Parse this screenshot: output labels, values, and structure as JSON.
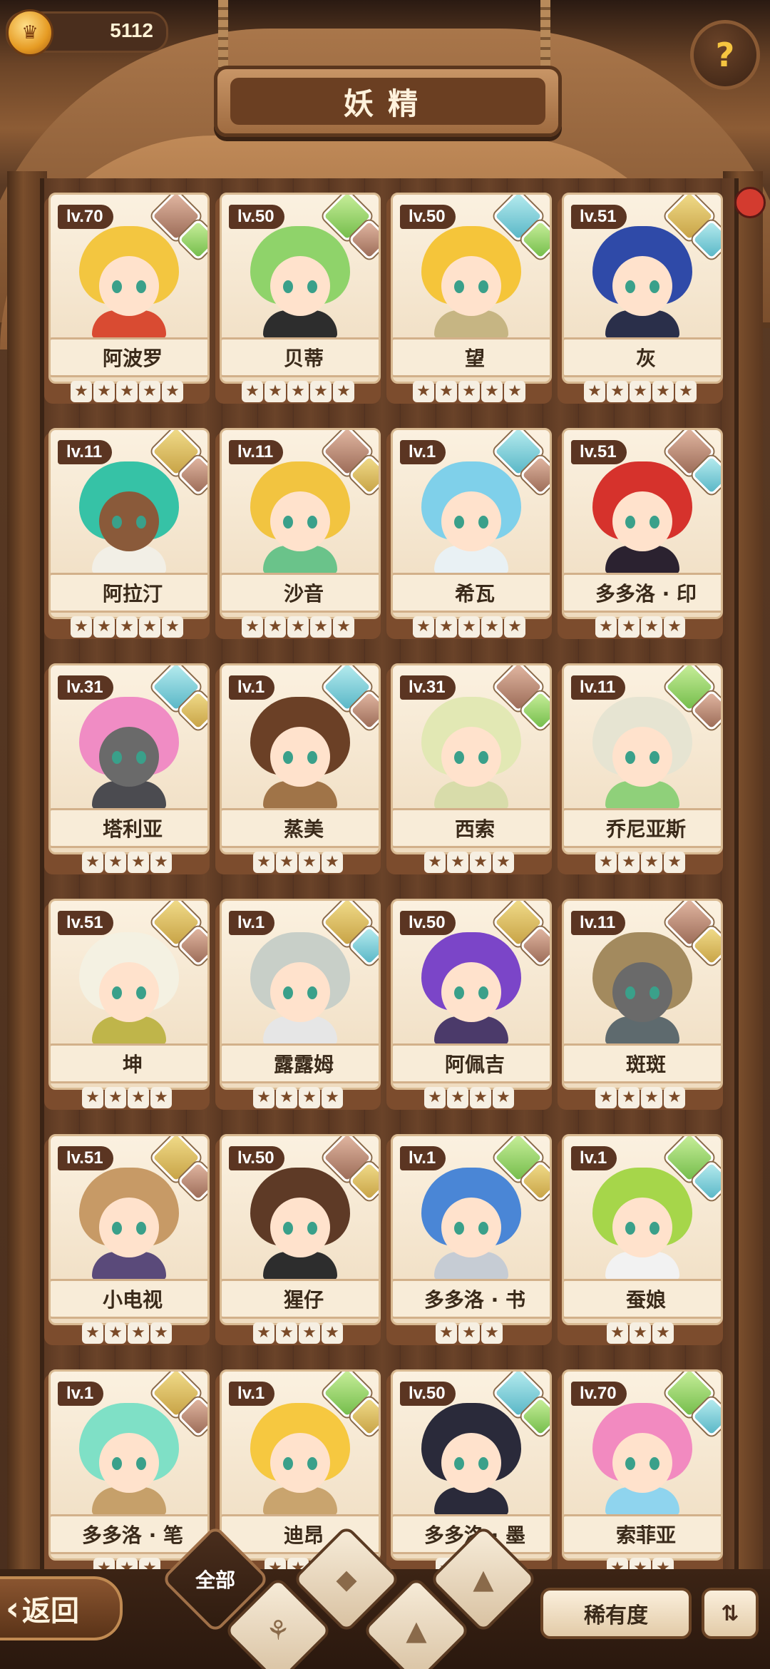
{
  "header": {
    "coins": "5112",
    "title": "妖精",
    "help_icon": "question-icon"
  },
  "bottom": {
    "back_label": "返回",
    "filter_all_label": "全部",
    "rarity_label": "稀有度",
    "sort_icon": "sort-icon"
  },
  "cards": [
    {
      "level": "lv.70",
      "name": "阿波罗",
      "stars": 5,
      "elements": [
        "rock",
        "plant"
      ],
      "hair": "#f3c640",
      "skin": "light",
      "shirt": "#d94b32"
    },
    {
      "level": "lv.50",
      "name": "贝蒂",
      "stars": 5,
      "elements": [
        "plant",
        "rock"
      ],
      "hair": "#8fd36a",
      "skin": "light",
      "shirt": "#2d2d2d"
    },
    {
      "level": "lv.50",
      "name": "望",
      "stars": 5,
      "elements": [
        "water",
        "plant"
      ],
      "hair": "#f5c53a",
      "skin": "light",
      "shirt": "#c6b583"
    },
    {
      "level": "lv.51",
      "name": "灰",
      "stars": 5,
      "elements": [
        "earth",
        "water"
      ],
      "hair": "#2f4aa8",
      "skin": "light",
      "shirt": "#2a2f4a"
    },
    {
      "level": "lv.11",
      "name": "阿拉汀",
      "stars": 5,
      "elements": [
        "earth",
        "rock"
      ],
      "hair": "#36c2a6",
      "skin": "dark",
      "shirt": "#f2efe6"
    },
    {
      "level": "lv.11",
      "name": "沙音",
      "stars": 5,
      "elements": [
        "rock",
        "earth"
      ],
      "hair": "#f2c440",
      "skin": "light",
      "shirt": "#6ac38a"
    },
    {
      "level": "lv.1",
      "name": "希瓦",
      "stars": 5,
      "elements": [
        "water",
        "rock"
      ],
      "hair": "#7fd0ea",
      "skin": "light",
      "shirt": "#e9f1f4"
    },
    {
      "level": "lv.51",
      "name": "多多洛 · 印",
      "stars": 4,
      "elements": [
        "rock",
        "water"
      ],
      "hair": "#d6322c",
      "skin": "light",
      "shirt": "#2b2230"
    },
    {
      "level": "lv.31",
      "name": "塔利亚",
      "stars": 4,
      "elements": [
        "water",
        "earth"
      ],
      "hair": "#f08cc4",
      "skin": "grey",
      "shirt": "#4b4b50"
    },
    {
      "level": "lv.1",
      "name": "蒸美",
      "stars": 4,
      "elements": [
        "water",
        "rock"
      ],
      "hair": "#6b4026",
      "skin": "light",
      "shirt": "#a07448"
    },
    {
      "level": "lv.31",
      "name": "西索",
      "stars": 4,
      "elements": [
        "rock",
        "plant"
      ],
      "hair": "#e2e8b4",
      "skin": "light",
      "shirt": "#d8dcaa"
    },
    {
      "level": "lv.11",
      "name": "乔尼亚斯",
      "stars": 4,
      "elements": [
        "plant",
        "rock"
      ],
      "hair": "#e6e4d2",
      "skin": "light",
      "shirt": "#8fd07a"
    },
    {
      "level": "lv.51",
      "name": "坤",
      "stars": 4,
      "elements": [
        "earth",
        "rock"
      ],
      "hair": "#f4f1e2",
      "skin": "light",
      "shirt": "#bfb54a"
    },
    {
      "level": "lv.1",
      "name": "露露姆",
      "stars": 4,
      "elements": [
        "earth",
        "water"
      ],
      "hair": "#c8cfc8",
      "skin": "light",
      "shirt": "#e6e6e6"
    },
    {
      "level": "lv.50",
      "name": "阿佩吉",
      "stars": 4,
      "elements": [
        "earth",
        "rock"
      ],
      "hair": "#7b45c8",
      "skin": "light",
      "shirt": "#4b3a6a"
    },
    {
      "level": "lv.11",
      "name": "斑斑",
      "stars": 4,
      "elements": [
        "rock",
        "earth"
      ],
      "hair": "#a38a5e",
      "skin": "grey",
      "shirt": "#5e6a6e"
    },
    {
      "level": "lv.51",
      "name": "小电视",
      "stars": 4,
      "elements": [
        "earth",
        "rock"
      ],
      "hair": "#c79a66",
      "skin": "light",
      "shirt": "#5a4a7a"
    },
    {
      "level": "lv.50",
      "name": "猩仔",
      "stars": 4,
      "elements": [
        "rock",
        "earth"
      ],
      "hair": "#5e3a26",
      "skin": "light",
      "shirt": "#2d2d2d"
    },
    {
      "level": "lv.1",
      "name": "多多洛 · 书",
      "stars": 3,
      "elements": [
        "plant",
        "earth"
      ],
      "hair": "#4a86d6",
      "skin": "light",
      "shirt": "#c6ccd4"
    },
    {
      "level": "lv.1",
      "name": "蚕娘",
      "stars": 3,
      "elements": [
        "plant",
        "water"
      ],
      "hair": "#a6d64a",
      "skin": "light",
      "shirt": "#f2f2f2"
    },
    {
      "level": "lv.1",
      "name": "多多洛 · 笔",
      "stars": 3,
      "elements": [
        "earth",
        "rock"
      ],
      "hair": "#7fe0c6",
      "skin": "light",
      "shirt": "#c6a06a"
    },
    {
      "level": "lv.1",
      "name": "迪昂",
      "stars": 3,
      "elements": [
        "plant",
        "earth"
      ],
      "hair": "#f6c840",
      "skin": "light",
      "shirt": "#c9a46e"
    },
    {
      "level": "lv.50",
      "name": "多多洛 · 墨",
      "stars": 3,
      "elements": [
        "water",
        "plant"
      ],
      "hair": "#2a2a3a",
      "skin": "light",
      "shirt": "#2a2a3a"
    },
    {
      "level": "lv.70",
      "name": "索菲亚",
      "stars": 3,
      "elements": [
        "plant",
        "water"
      ],
      "hair": "#f28ac0",
      "skin": "light",
      "shirt": "#8fd4ee"
    }
  ],
  "colors": {
    "accent": "#5b3522",
    "paper": "#fbf1e0",
    "wood": "#7c4c2d"
  }
}
